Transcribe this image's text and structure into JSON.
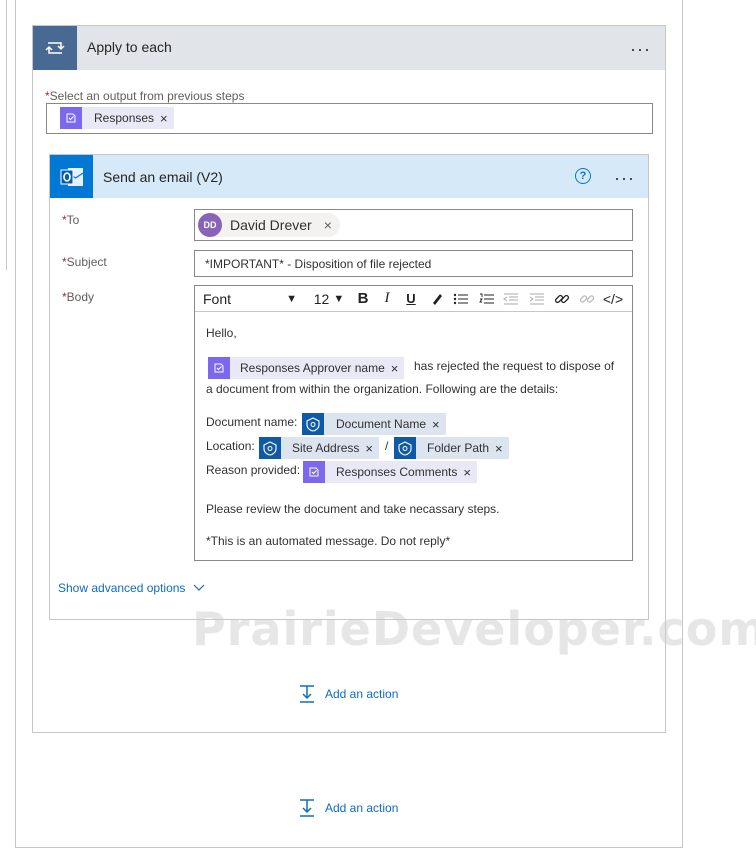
{
  "loop": {
    "title": "Apply to each",
    "menu": "···",
    "select_label": "Select an output from previous steps",
    "required_mark": "*",
    "token": "Responses",
    "remove": "×"
  },
  "email": {
    "title": "Send an email (V2)",
    "help": "?",
    "menu": "···",
    "to_label": "To",
    "to_avatar_initials": "DD",
    "to_name": "David Drever",
    "subject_label": "Subject",
    "subject_value": "*IMPORTANT* - Disposition of file rejected",
    "body_label": "Body",
    "toolbar": {
      "font": "Font",
      "size": "12",
      "bold": "B",
      "italic": "I",
      "underline": "U"
    },
    "body": {
      "greeting": "Hello,",
      "approver_token": "Responses Approver name",
      "line1_rest": "has rejected the request to dispose of",
      "line2": "a document from within the organization.  Following are the details:",
      "docname_label": "Document name:",
      "docname_token": "Document Name",
      "location_label": "Location:",
      "site_token": "Site Address",
      "slash": "/",
      "folder_token": "Folder Path",
      "reason_label": "Reason provided:",
      "reason_token": "Responses Comments",
      "review": "Please review the document and take necassary steps.",
      "footer": "*This is an automated message.  Do not reply*"
    },
    "advanced": "Show advanced options"
  },
  "actions": {
    "inner_add": "Add an action",
    "outer_add": "Add an action"
  },
  "watermark": "PrairieDeveloper.com",
  "colors": {
    "loop_header": "#e1e4e9",
    "loop_icon": "#486991",
    "email_header": "#d6e9f8",
    "outlook_blue": "#0078d4",
    "token_purple": "#7b68ee",
    "token_navy": "#0f5aa8",
    "link": "#0f6cbd",
    "required": "#a4262c"
  }
}
